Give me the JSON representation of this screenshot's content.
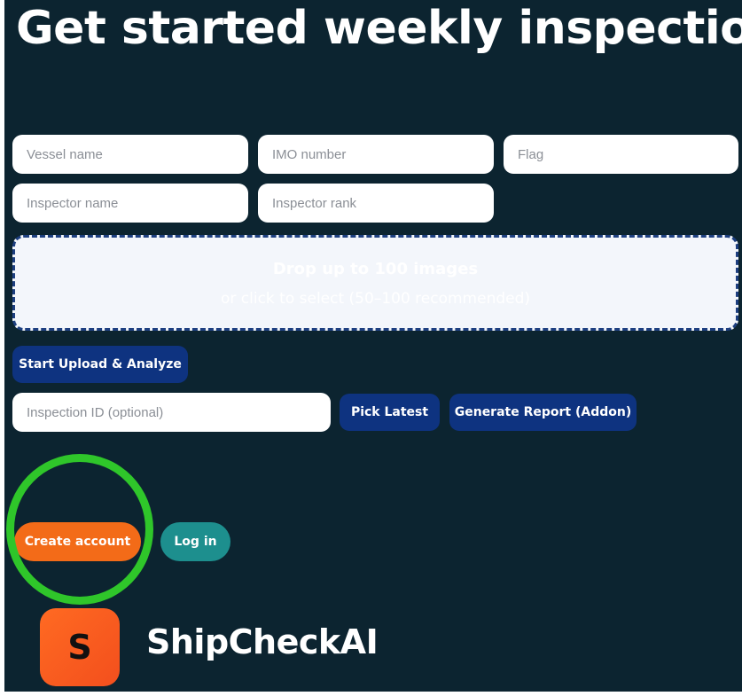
{
  "header": {
    "title": "Get started weekly inspection"
  },
  "form": {
    "vessel_name": {
      "placeholder": "Vessel name",
      "value": ""
    },
    "imo_number": {
      "placeholder": "IMO number",
      "value": ""
    },
    "flag": {
      "placeholder": "Flag",
      "value": ""
    },
    "inspector_name": {
      "placeholder": "Inspector name",
      "value": ""
    },
    "inspector_rank": {
      "placeholder": "Inspector rank",
      "value": ""
    }
  },
  "dropzone": {
    "title": "Drop up to 100 images",
    "subtitle": "or click to select (50–100 recommended)"
  },
  "actions": {
    "start_upload": "Start Upload & Analyze",
    "inspection_id": {
      "placeholder": "Inspection ID (optional)",
      "value": ""
    },
    "pick_latest": "Pick Latest",
    "generate_report": "Generate Report (Addon)"
  },
  "auth": {
    "create_account": "Create account",
    "log_in": "Log in"
  },
  "brand": {
    "logo_letter": "S",
    "name": "ShipCheckAI"
  },
  "colors": {
    "background": "#0c2430",
    "primary_button": "#0e3380",
    "create_account": "#f36b18",
    "log_in": "#1d8f8e",
    "highlight_ring": "#2fc62a",
    "logo": "#f36b18"
  }
}
